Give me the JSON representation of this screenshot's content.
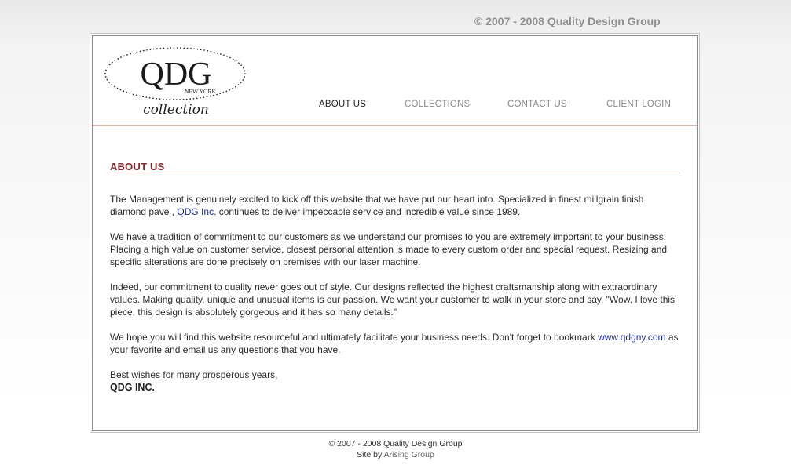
{
  "header": {
    "copyright_top": "© 2007 - 2008 Quality Design Group"
  },
  "logo": {
    "mark": "QDG",
    "sub": "NEW YORK",
    "tagline": "collection"
  },
  "nav": {
    "items": [
      {
        "label": "ABOUT US",
        "active": true
      },
      {
        "label": "COLLECTIONS",
        "active": false
      },
      {
        "label": "CONTACT US",
        "active": false
      },
      {
        "label": "CLIENT LOGIN",
        "active": false
      }
    ]
  },
  "main": {
    "title": "ABOUT US",
    "p1_a": "The Management is genuinely excited to kick off this website that we have put our heart into.  Specialized in finest millgrain finish diamond pave , ",
    "p1_link": "QDG Inc.",
    "p1_b": " continues to deliver impeccable service and incredible value since 1989.",
    "p2": "We have a tradition of commitment to our customers as we understand our promises to you are extremely important to your business. Placing a high value on customer service, closest personal attention is made to every custom order and special request. Resizing and specific alterations are done precisely on premises with our laser machine.",
    "p3": "Indeed, our commitment to quality never goes out of style.  Our designs reflected the highest craftsmanship along with extraordinary values.  Making quality, unique and unusual items is our passion.   We want your customer to walk in your store and say, \"Wow, I love this piece, this design is absolutely gorgeous and it has so many details.\"",
    "p4_a": "We hope you will find this website resourceful and ultimately facilitate your business needs.  Don't forget to bookmark ",
    "p4_link": "www.qdgny.com",
    "p4_b": " as your favorite and email us any questions that you have.",
    "signoff": "Best wishes for many prosperous years,",
    "signoff_name": "QDG INC."
  },
  "footer": {
    "copyright": "© 2007 - 2008 Quality Design Group",
    "site_by_prefix": "Site by ",
    "site_by_link": "Arising Group"
  },
  "colors": {
    "title": "#8b2b2e",
    "link": "#1c2d8c",
    "rule": "#cfb7ad"
  }
}
